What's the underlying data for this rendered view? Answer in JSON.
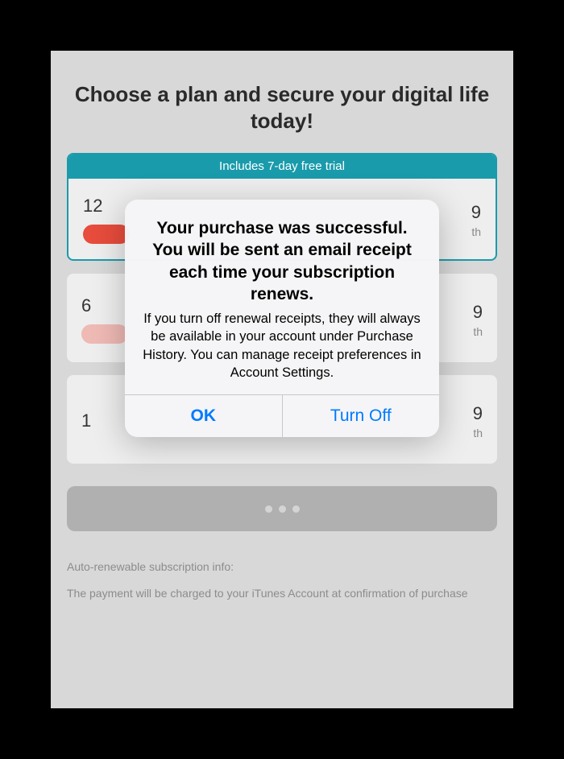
{
  "page": {
    "headline": "Choose a plan and secure your digital life today!",
    "trial_banner": "Includes 7-day free trial",
    "plans": [
      {
        "duration_left": "12",
        "price_right": "9",
        "period_suffix": "th"
      },
      {
        "duration_left": "6",
        "price_right": "9",
        "period_suffix": "th"
      },
      {
        "duration_left": "1",
        "price_right": "9",
        "period_suffix": "th"
      }
    ],
    "info_heading": "Auto-renewable subscription info:",
    "info_body": "The payment will be charged to your iTunes Account at confirmation of purchase"
  },
  "alert": {
    "title": "Your purchase was successful. You will be sent an email receipt each time your subscription renews.",
    "message": "If you turn off renewal receipts, they will always be available in your account under Purchase History. You can manage receipt preferences in Account Settings.",
    "ok_label": "OK",
    "turn_off_label": "Turn Off"
  }
}
